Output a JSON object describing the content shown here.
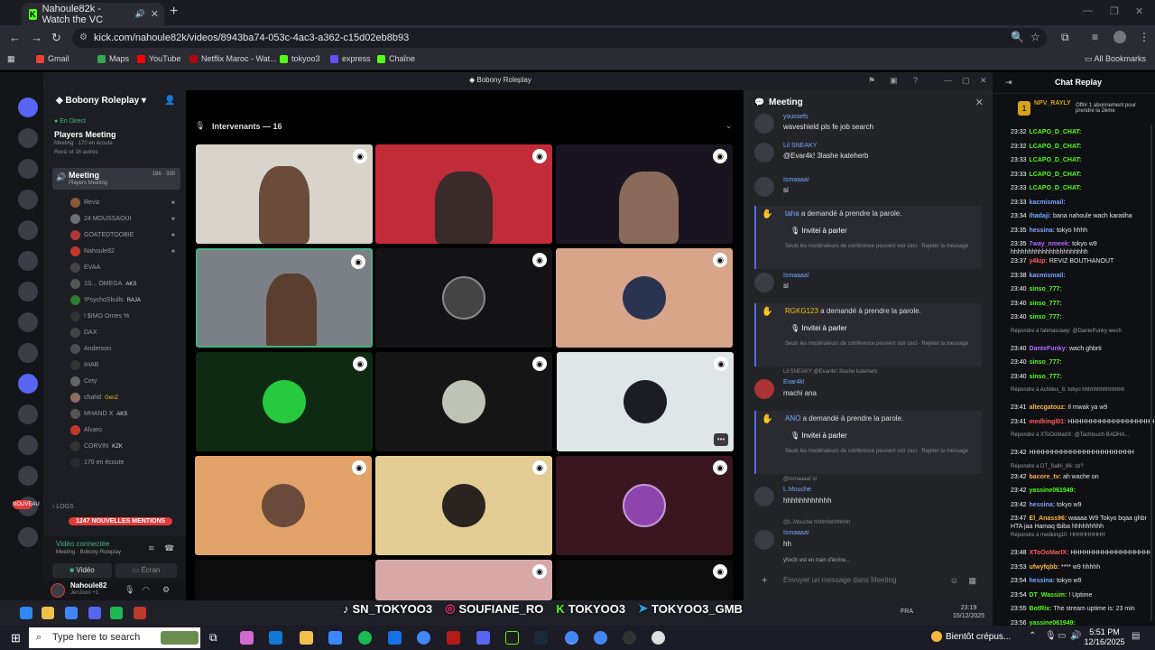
{
  "browser": {
    "tab_title": "Nahoule82k - Watch the VC",
    "url": "kick.com/nahoule82k/videos/8943ba74-053c-4ac3-a362-c15d02eb8b93",
    "bookmarks": [
      "Gmail",
      "Maps",
      "YouTube",
      "Netflix Maroc - Wat...",
      "tokyoo3",
      "express",
      "Chaîne"
    ],
    "all_bookmarks": "All Bookmarks"
  },
  "discord": {
    "server_name": "Bobony Roleplay",
    "window_title": "Bobony Roleplay",
    "live_tag": "En Direct",
    "live_title": "Players Meeting",
    "live_sub1": "Meeting · 170 en écoute",
    "live_sub2": "Reviz et 16 autres",
    "channel": {
      "name": "Meeting",
      "sub": "Players Meeting",
      "count": "186 · 330"
    },
    "members": [
      "Reviz",
      "24 MOUSSAOUI",
      "GOATEDTOOBIE",
      "Nahoule82",
      "EVAA",
      "1S... OMEGA",
      "!PsychoSkulls",
      "! $IMO Ornes %",
      "DAX",
      "Anderson",
      "IHAB",
      "Cety",
      "chahd",
      "MHAND X",
      "Alvaro",
      "CORVIN",
      "170 en écoute"
    ],
    "member_tags": {
      "5": "AKS",
      "6": "RAJA",
      "12": "GenZ",
      "13": "AKS",
      "15": "KZK"
    },
    "logs": "LOGS",
    "mentions": "1247 NOUVELLES MENTIONS",
    "nouveau": "NOUVEAU",
    "voice_connected": "Vidéo connectée",
    "voice_sub": "Meeting · Bobony Roleplay",
    "btn_video": "Vidéo",
    "btn_screen": "Écran",
    "user_name": "Nahoule82",
    "user_sub": "JenJoon +1",
    "speakers_label": "Intervenants — 16"
  },
  "meeting_chat": {
    "title": "Meeting",
    "messages": [
      {
        "name": "youssefs",
        "text": "waveshield pls fe job search"
      },
      {
        "name": "Lil SNEAKY",
        "text": "@Evar4k! 3lashe kateherb"
      },
      {
        "name": "Ismaaaa!",
        "text": "si"
      },
      {
        "name": "Ismaaaa!",
        "text": "si"
      },
      {
        "name": "Evar4k!",
        "text": "machi ana"
      },
      {
        "name": "L.Mouche",
        "text": "hhhhhhhhhhhh"
      },
      {
        "name": "Ismaaaa!",
        "text": "hh"
      }
    ],
    "reply_hint1": "Lil SNEAKY @Evar4k! 3lashe kateherb",
    "reply_hint2": "@Ismaaaa! si",
    "reply_hint3": "@L.Mouche hhhhhhhhhhhh",
    "requests": [
      {
        "who": "taha",
        "text": "a demandé à prendre la parole."
      },
      {
        "who": "RGKG123",
        "text": "a demandé à prendre la parole."
      },
      {
        "who": "ANO",
        "text": "a demandé à prendre la parole."
      }
    ],
    "invite_label": "Invitei à parler",
    "mod_note": "Seuls les modérateurs de conférence peuvent voir ceci · Rejeter la message",
    "typing": "yfox3r est en train d'écrire...",
    "input_placeholder": "Envoyer un message dans Meeting"
  },
  "overlay": {
    "handles": [
      "SN_TOKYOO3",
      "SOUFIANE_RO",
      "TOKYOO3",
      "TOKYOO3_GMB"
    ]
  },
  "inner_taskbar": {
    "lang": "FRA",
    "time": "23:19",
    "date": "15/12/2025"
  },
  "chat_replay": {
    "title": "Chat Replay",
    "pinned_user": "NPV_RAYLY",
    "pinned_desc": "Offrir 1 abonnement pour prendre la 2ème",
    "lines": [
      {
        "t": "23:32",
        "u": "LCAPO_D_CHAT:",
        "m": "",
        "c": "#53fc18"
      },
      {
        "t": "23:32",
        "u": "LCAPO_D_CHAT:",
        "m": "",
        "c": "#53fc18"
      },
      {
        "t": "23:33",
        "u": "LCAPO_D_CHAT:",
        "m": "",
        "c": "#53fc18"
      },
      {
        "t": "23:33",
        "u": "LCAPO_D_CHAT:",
        "m": "",
        "c": "#53fc18"
      },
      {
        "t": "23:33",
        "u": "LCAPO_D_CHAT:",
        "m": "",
        "c": "#53fc18"
      },
      {
        "t": "23:33",
        "u": "kacmismail:",
        "m": "",
        "c": "#7aa7ff"
      },
      {
        "t": "23:34",
        "u": "Ihadaji:",
        "m": "bana nahoule wach karatiha",
        "c": "#7aa7ff"
      },
      {
        "t": "23:35",
        "u": "hessina:",
        "m": "tokyo hhhh",
        "c": "#7aa7ff"
      },
      {
        "t": "23:35",
        "u": "7way_nmeek:",
        "m": "tokyo w9 hhhhhhhhhhhhhhhhhhhhhh",
        "c": "#b068ff"
      },
      {
        "t": "23:37",
        "u": "y4kip:",
        "m": "REVIZ BOUTHANOUT",
        "c": "#ff5a5a"
      },
      {
        "t": "23:38",
        "u": "kacmismail:",
        "m": "",
        "c": "#7aa7ff"
      },
      {
        "t": "23:40",
        "u": "sinso_777:",
        "m": "",
        "c": "#53fc18"
      },
      {
        "t": "23:40",
        "u": "sinso_777:",
        "m": "",
        "c": "#53fc18"
      },
      {
        "t": "23:40",
        "u": "sinso_777:",
        "m": "",
        "c": "#53fc18"
      },
      {
        "t": "",
        "u": "",
        "m": "Répondre à fatimasrawy: @DantePunky wech",
        "c": "#999",
        "reply": true
      },
      {
        "t": "23:40",
        "u": "DanteFunky:",
        "m": "wach ghbrti",
        "c": "#b068ff"
      },
      {
        "t": "23:40",
        "u": "sinso_777:",
        "m": "",
        "c": "#53fc18"
      },
      {
        "t": "23:40",
        "u": "sinso_777:",
        "m": "",
        "c": "#53fc18"
      },
      {
        "t": "",
        "u": "",
        "m": "Répondre à Achilles_6: tokyo hhhhhhhhhhhhhh",
        "c": "#999",
        "reply": true
      },
      {
        "t": "23:41",
        "u": "altecgatouz:",
        "m": "Il mwak ya w9",
        "c": "#ffb347"
      },
      {
        "t": "23:41",
        "u": "medkingl01:",
        "m": "HHHHHHHHHHHHHHHHHHHHHHHH",
        "c": "#ff5a5a"
      },
      {
        "t": "",
        "u": "",
        "m": "Répondre à XToOoMarIX: @Tachtouch BADHA...",
        "c": "#999",
        "reply": true
      },
      {
        "t": "23:42",
        "u": "",
        "m": "HHHHHHHHHHHHHHHHHHHHHHH",
        "c": "#e6e6ea"
      },
      {
        "t": "",
        "u": "",
        "m": "Répondre à DT_Salhi_86: cb?",
        "c": "#999",
        "reply": true
      },
      {
        "t": "23:42",
        "u": "bacore_tv:",
        "m": "ah wache on",
        "c": "#ffb347"
      },
      {
        "t": "23:42",
        "u": "yassine061949:",
        "m": "",
        "c": "#53fc18"
      },
      {
        "t": "23:42",
        "u": "hessina:",
        "m": "tokyo w9",
        "c": "#7aa7ff"
      },
      {
        "t": "23:47",
        "u": "El_Anass96:",
        "m": "waaaa W9 Tokyo bqaa ghbr HTA jaa Hamaq tbiba hhhhhhhhh",
        "c": "#ffb347"
      },
      {
        "t": "",
        "u": "",
        "m": "Répondre à medking10: HHHHHHHHH",
        "c": "#999",
        "reply": true
      },
      {
        "t": "23:48",
        "u": "XToOoMarIX:",
        "m": "HHHHHHHHHHHHHHHHHH",
        "c": "#ff5a5a"
      },
      {
        "t": "23:53",
        "u": "ufwyfqbb:",
        "m": "**** w9 hhhhh",
        "c": "#ffb347"
      },
      {
        "t": "23:54",
        "u": "hessina:",
        "m": "tokyo w9",
        "c": "#7aa7ff"
      },
      {
        "t": "23:54",
        "u": "DT_Wassim:",
        "m": "! Uptime",
        "c": "#53fc18"
      },
      {
        "t": "23:55",
        "u": "BotRix:",
        "m": "The stream uptime is: 23 min",
        "c": "#53fc18"
      },
      {
        "t": "23:56",
        "u": "yassine061949:",
        "m": "",
        "c": "#53fc18"
      }
    ]
  },
  "taskbar": {
    "search_placeholder": "Type here to search",
    "weather": "Bientôt crépus...",
    "time": "5:51 PM",
    "date": "12/16/2025"
  }
}
